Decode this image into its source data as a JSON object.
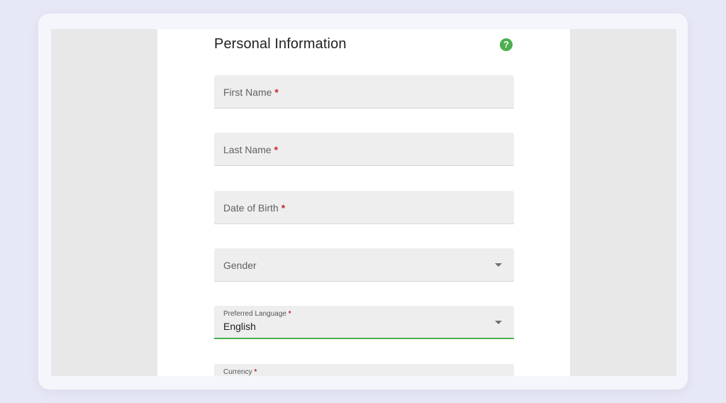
{
  "form": {
    "title": "Personal Information",
    "help_icon": "?",
    "required_mark": "*",
    "fields": [
      {
        "label": "First Name",
        "required": true,
        "value": ""
      },
      {
        "label": "Last Name",
        "required": true,
        "value": ""
      },
      {
        "label": "Date of Birth",
        "required": true,
        "value": ""
      },
      {
        "label": "Gender",
        "required": false,
        "value": "",
        "type": "select"
      },
      {
        "label": "Preferred Language",
        "required": true,
        "value": "English",
        "type": "select",
        "focused": true
      },
      {
        "label": "Currency",
        "required": true,
        "value": "",
        "type": "select"
      }
    ]
  },
  "colors": {
    "accent": "#4caf50",
    "required": "#c62828",
    "field_bg": "#eeeeee",
    "page_bg": "#e7e8f6"
  },
  "icons": {
    "help": "help-circle-icon",
    "dropdown": "dropdown-arrow-icon"
  }
}
